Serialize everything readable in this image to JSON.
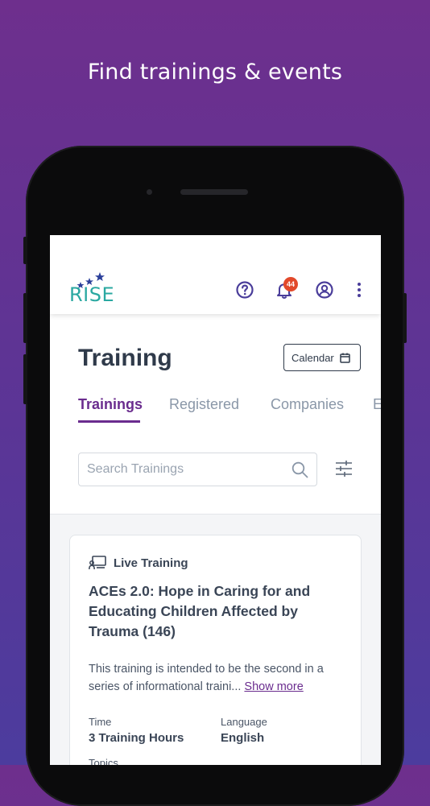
{
  "promo": {
    "headline": "Find trainings & events"
  },
  "app": {
    "logo_text": "RISE",
    "notification_count": "44",
    "colors": {
      "brand_purple": "#6a2c8e",
      "logo_teal": "#2aa8a1",
      "badge": "#e2492b",
      "logo_star": "#2b3f9a"
    }
  },
  "icons": {
    "help": "help-circle-icon",
    "notifications": "bell-icon",
    "account": "user-circle-icon",
    "menu": "more-vertical-icon",
    "calendar": "calendar-icon",
    "search": "search-icon",
    "filter": "sliders-icon",
    "training_type": "presentation-icon"
  },
  "page": {
    "title": "Training",
    "calendar_label": "Calendar",
    "tabs": [
      {
        "label": "Trainings",
        "active": true
      },
      {
        "label": "Registered",
        "active": false
      },
      {
        "label": "Companies",
        "active": false
      },
      {
        "label": "E",
        "active": false
      }
    ],
    "search": {
      "placeholder": "Search Trainings",
      "value": ""
    }
  },
  "training_card": {
    "type": "Live Training",
    "title": "ACEs 2.0: Hope in Caring for and Educating Children Affected by Trauma (146)",
    "description": "This training is intended to be the second in a series of informational traini...",
    "show_more": "Show more",
    "time_label": "Time",
    "time_value": "3 Training Hours",
    "language_label": "Language",
    "language_value": "English",
    "topics_label": "Topics"
  }
}
